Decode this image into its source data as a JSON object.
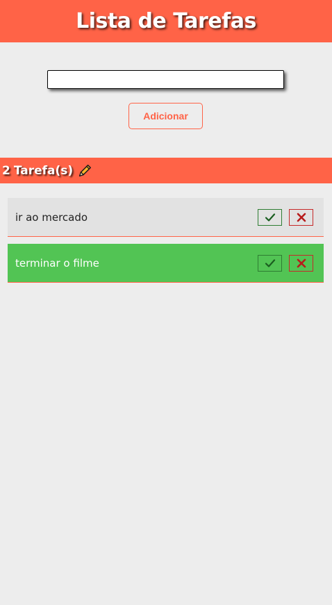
{
  "header": {
    "title": "Lista de Tarefas"
  },
  "form": {
    "input_value": "",
    "input_placeholder": "",
    "add_label": "Adicionar"
  },
  "counter": {
    "count": "2",
    "label": "Tarefa(s)",
    "icon": "pencil-icon"
  },
  "tasks": [
    {
      "text": "ir ao mercado",
      "status": "pending"
    },
    {
      "text": "terminar o filme",
      "status": "done"
    }
  ],
  "colors": {
    "accent": "#ff6347",
    "background": "#ededed",
    "task_pending": "#e2e2e2",
    "task_done": "#52c454",
    "check": "#2e7d32",
    "delete": "#c62828"
  }
}
